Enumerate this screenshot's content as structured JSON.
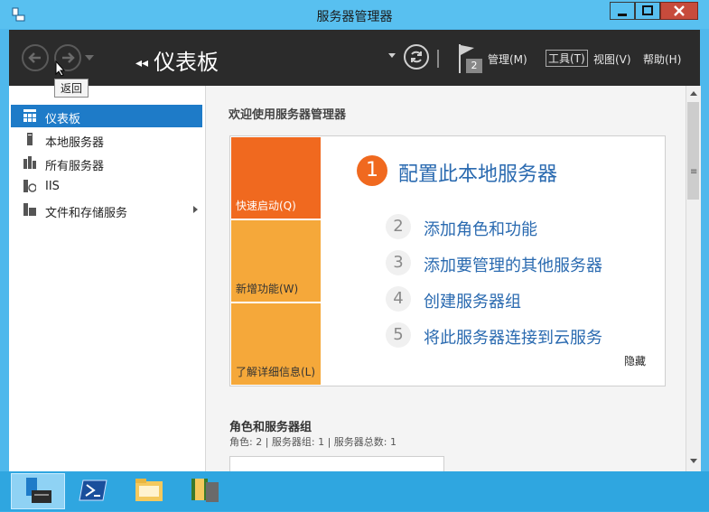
{
  "window": {
    "title": "服务器管理器",
    "controls": {
      "minimize": "minimize-icon",
      "maximize": "maximize-icon",
      "close": "close-icon"
    }
  },
  "toolbar": {
    "back_tooltip": "返回",
    "breadcrumb": "仪表板",
    "notification_count": "2",
    "menus": [
      "管理(M)",
      "工具(T)",
      "视图(V)",
      "帮助(H)"
    ]
  },
  "sidebar": {
    "items": [
      {
        "label": "仪表板",
        "icon": "dashboard-icon",
        "active": true
      },
      {
        "label": "本地服务器",
        "icon": "local-server-icon",
        "active": false
      },
      {
        "label": "所有服务器",
        "icon": "all-servers-icon",
        "active": false
      },
      {
        "label": "IIS",
        "icon": "iis-icon",
        "active": false
      },
      {
        "label": "文件和存储服务",
        "icon": "storage-icon",
        "active": false,
        "has_arrow": true
      }
    ]
  },
  "main": {
    "welcome": "欢迎使用服务器管理器",
    "tiles": [
      {
        "label": "快速启动(Q)",
        "color": "#f0691f"
      },
      {
        "label": "新增功能(W)",
        "color": "#f5a83a"
      },
      {
        "label": "了解详细信息(L)",
        "color": "#f5a83a"
      }
    ],
    "steps": [
      {
        "num": "1",
        "text": "配置此本地服务器"
      },
      {
        "num": "2",
        "text": "添加角色和功能"
      },
      {
        "num": "3",
        "text": "添加要管理的其他服务器"
      },
      {
        "num": "4",
        "text": "创建服务器组"
      },
      {
        "num": "5",
        "text": "将此服务器连接到云服务"
      }
    ],
    "hide_label": "隐藏",
    "roles_title": "角色和服务器组",
    "roles_summary": "角色: 2 | 服务器组: 1 | 服务器总数: 1"
  },
  "taskbar": {
    "items": [
      "server-manager-icon",
      "powershell-icon",
      "file-explorer-icon",
      "iis-manager-icon"
    ]
  },
  "colors": {
    "accent_blue": "#1e7bc8",
    "link_blue": "#2a6ab0",
    "orange": "#f0691f",
    "light_orange": "#f5a83a",
    "toolbar_dark": "#2b2b2b"
  }
}
